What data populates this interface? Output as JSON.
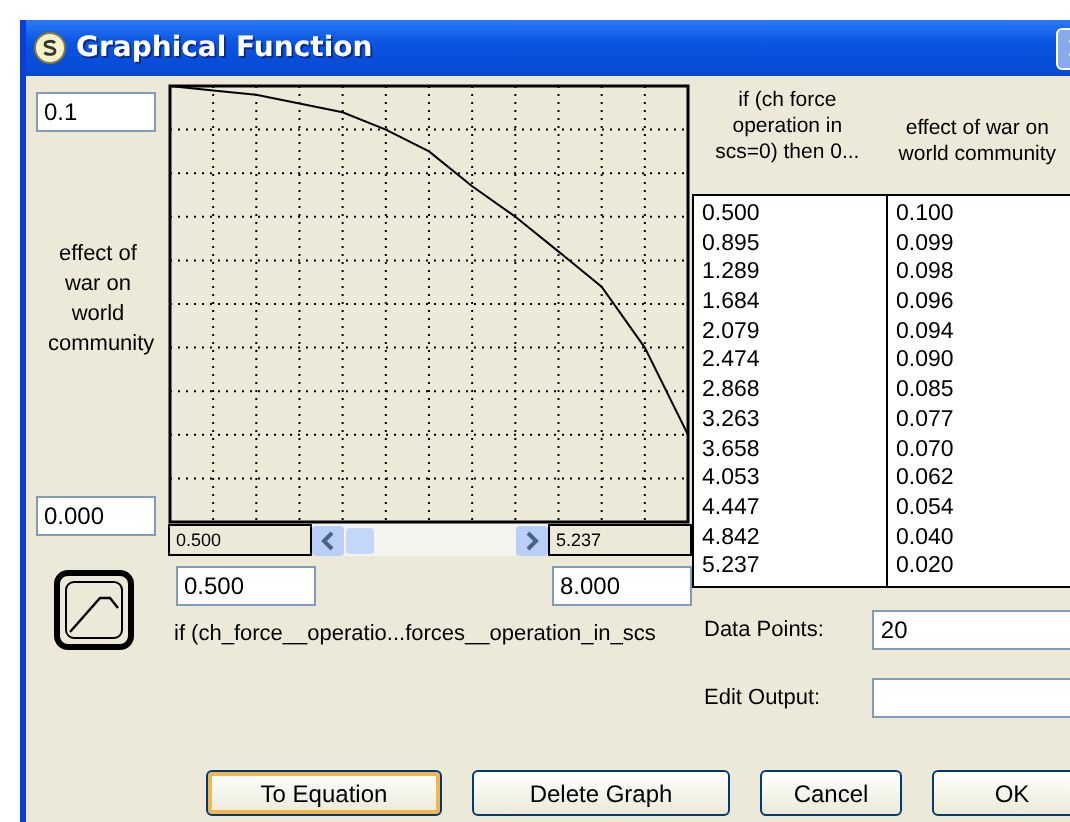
{
  "window": {
    "title": "Graphical Function"
  },
  "y_max": "0.1",
  "y_label": "effect of war on world community",
  "y_min": "0.000",
  "scroll": {
    "start_label": "0.500",
    "end_label": "5.237"
  },
  "x_min": "0.500",
  "x_max": "8.000",
  "x_label": "if (ch_force__operatio...forces__operation_in_scs",
  "table": {
    "columns": [
      "if (ch force operation in scs=0) then 0...",
      "effect of  war on world community"
    ],
    "rows": [
      [
        "0.500",
        "0.100"
      ],
      [
        "0.895",
        "0.099"
      ],
      [
        "1.289",
        "0.098"
      ],
      [
        "1.684",
        "0.096"
      ],
      [
        "2.079",
        "0.094"
      ],
      [
        "2.474",
        "0.090"
      ],
      [
        "2.868",
        "0.085"
      ],
      [
        "3.263",
        "0.077"
      ],
      [
        "3.658",
        "0.070"
      ],
      [
        "4.053",
        "0.062"
      ],
      [
        "4.447",
        "0.054"
      ],
      [
        "4.842",
        "0.040"
      ],
      [
        "5.237",
        "0.020"
      ]
    ]
  },
  "data_points": {
    "label": "Data Points:",
    "value": "20"
  },
  "edit_output": {
    "label": "Edit Output:"
  },
  "buttons": [
    {
      "label": "To Equation",
      "focused": true
    },
    {
      "label": "Delete Graph",
      "focused": false
    },
    {
      "label": "Cancel",
      "focused": false
    },
    {
      "label": "OK",
      "focused": false
    }
  ]
}
